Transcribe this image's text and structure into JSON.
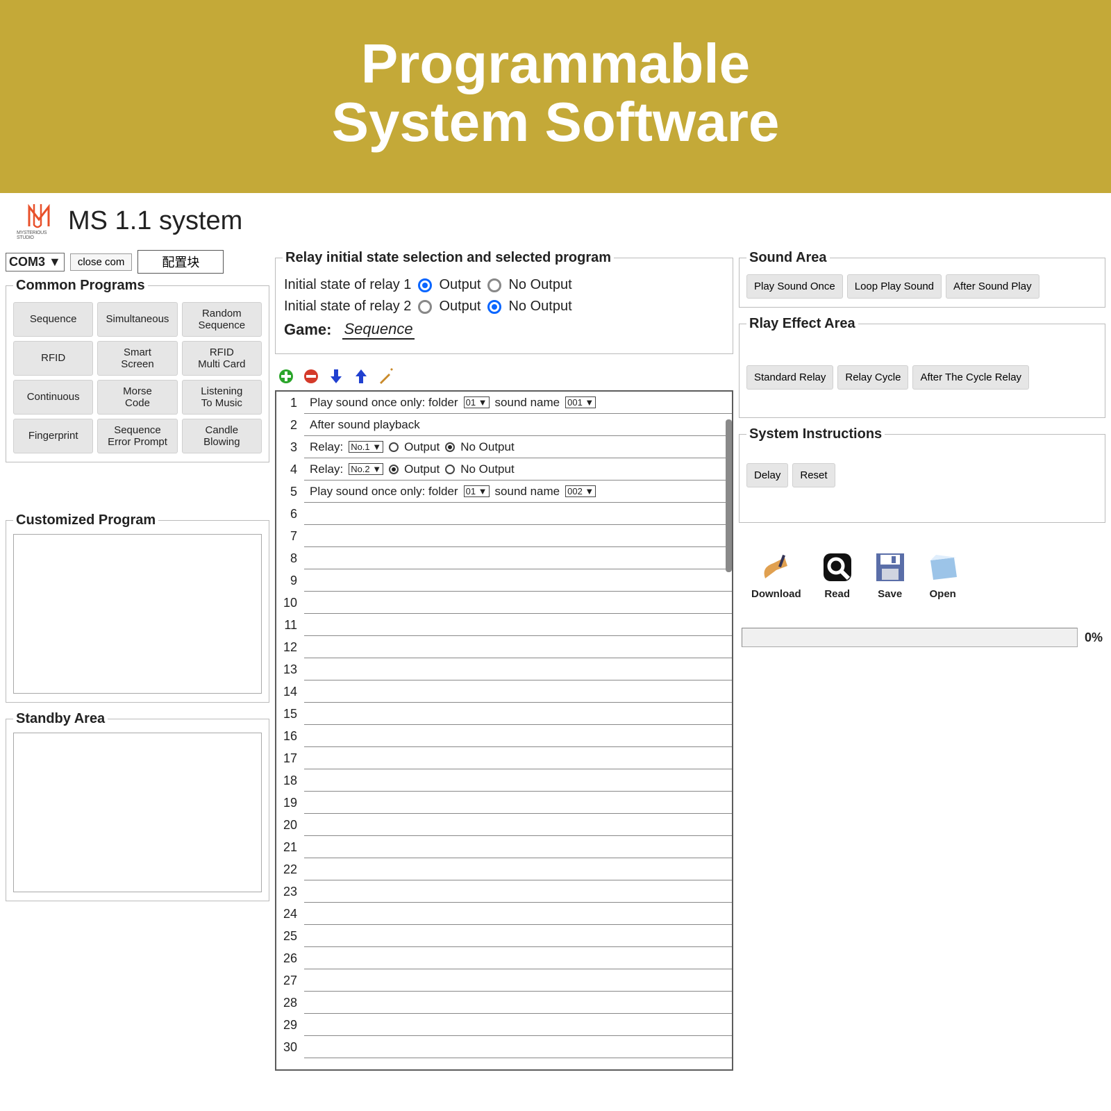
{
  "banner": {
    "line1": "Programmable",
    "line2": "System Software"
  },
  "app": {
    "title": "MS 1.1 system",
    "logo_sub": "MYSTERIOUS STUDIO"
  },
  "top": {
    "com": "COM3",
    "close": "close  com",
    "config": "配置块"
  },
  "common_programs": {
    "legend": "Common Programs",
    "items": [
      "Sequence",
      "Simultaneous",
      "Random Sequence",
      "RFID",
      "Smart Screen",
      "RFID Multi Card",
      "Continuous",
      "Morse Code",
      "Listening To Music",
      "Fingerprint",
      "Sequence Error Prompt",
      "Candle Blowing"
    ]
  },
  "customized": {
    "legend": "Customized Program"
  },
  "standby": {
    "legend": "Standby Area"
  },
  "relay": {
    "legend": "Relay initial state selection and selected program",
    "r1_label": "Initial state of relay 1",
    "r2_label": "Initial state of relay 2",
    "output": "Output",
    "nooutput": "No Output",
    "game_label": "Game:",
    "game_value": "Sequence"
  },
  "editor": {
    "row1": {
      "prefix": "Play sound once only: folder",
      "folder": "01 ▼",
      "mid": "sound name",
      "sound": "001 ▼"
    },
    "row2": {
      "text": "After sound playback"
    },
    "row3": {
      "prefix": "Relay:",
      "sel": "No.1 ▼",
      "opt1": "Output",
      "opt2": "No Output"
    },
    "row4": {
      "prefix": "Relay:",
      "sel": "No.2 ▼",
      "opt1": "Output",
      "opt2": "No Output"
    },
    "row5": {
      "prefix": "Play sound once only: folder",
      "folder": "01 ▼",
      "mid": "sound name",
      "sound": "002 ▼"
    }
  },
  "sound_area": {
    "legend": "Sound Area",
    "b1": "Play Sound Once",
    "b2": "Loop Play Sound",
    "b3": "After Sound Play"
  },
  "relay_area": {
    "legend": "Rlay Effect Area",
    "b1": "Standard Relay",
    "b2": "Relay Cycle",
    "b3": "After The Cycle Relay"
  },
  "sys_instr": {
    "legend": "System Instructions",
    "b1": "Delay",
    "b2": "Reset"
  },
  "io": {
    "download": "Download",
    "read": "Read",
    "save": "Save",
    "open": "Open"
  },
  "progress": {
    "value": "0%"
  }
}
